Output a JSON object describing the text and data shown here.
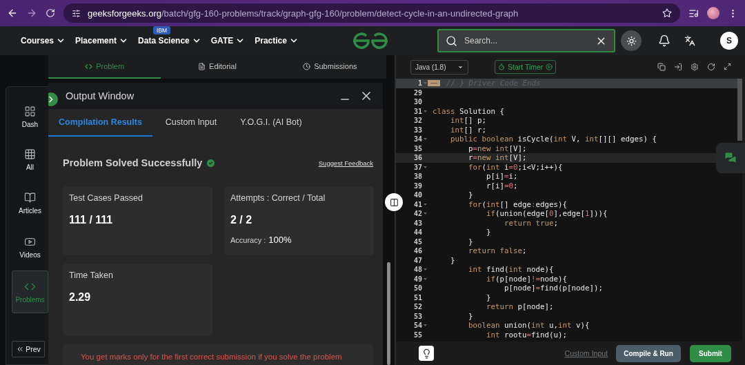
{
  "browser": {
    "url_host": "geeksforgeeks.org",
    "url_path": "/batch/gfg-160-problems/track/graph-gfg-160/problem/detect-cycle-in-an-undirected-graph"
  },
  "nav": {
    "items": [
      {
        "label": "Courses"
      },
      {
        "label": "Placement"
      },
      {
        "label": "Data Science",
        "badge": "IBM"
      },
      {
        "label": "GATE"
      },
      {
        "label": "Practice"
      }
    ],
    "search": {
      "placeholder": "Search..."
    },
    "avatar": "S"
  },
  "problem_tabs": [
    {
      "label": "Problem",
      "selected": true
    },
    {
      "label": "Editorial",
      "selected": false
    },
    {
      "label": "Submissions",
      "selected": false
    }
  ],
  "sidebar": {
    "items": [
      {
        "label": "Dash",
        "selected": false
      },
      {
        "label": "All",
        "selected": false
      },
      {
        "label": "Articles",
        "selected": false
      },
      {
        "label": "Videos",
        "selected": false
      },
      {
        "label": "Problems",
        "selected": true
      }
    ],
    "prev": "Prev"
  },
  "output_window": {
    "title": "Output Window",
    "tabs": [
      {
        "label": "Compilation Results",
        "selected": true
      },
      {
        "label": "Custom Input",
        "selected": false
      },
      {
        "label": "Y.O.G.I. (AI Bot)",
        "selected": false
      }
    ],
    "status": "Problem Solved Successfully",
    "feedback_link": "Suggest Feedback",
    "cards": [
      {
        "label": "Test Cases Passed",
        "value": "111 / 111"
      },
      {
        "label": "Attempts : Correct / Total",
        "value": "2 / 2",
        "extra_label": "Accuracy :",
        "extra_value": "100%"
      },
      {
        "label": "Time Taken",
        "value": "2.29"
      }
    ],
    "notice": "You get marks only for the first correct submission if you solve the problem"
  },
  "editor": {
    "language": "Java (1.8)",
    "timer": "Start Timer",
    "custom_input": "Custom Input",
    "run": "Compile & Run",
    "submit": "Submit",
    "lines": [
      {
        "n": "1",
        "fold": true,
        "folded": true,
        "active": false,
        "tokens": [
          {
            "kind": "comment",
            "text": "// } Driver Code Ends"
          }
        ]
      },
      {
        "n": "29",
        "fold": false,
        "folded": false,
        "active": false
      },
      {
        "n": "30",
        "fold": false,
        "folded": false,
        "active": false
      },
      {
        "n": "31",
        "fold": true,
        "folded": false,
        "active": false,
        "tokens": [
          {
            "kind": "keyword",
            "text": "class"
          },
          {
            "kind": "plain",
            "text": " Solution {"
          }
        ]
      },
      {
        "n": "32",
        "fold": false,
        "folded": false,
        "active": false,
        "tokens": [
          {
            "kind": "keyword",
            "text": "    int"
          },
          {
            "kind": "plain",
            "text": "[] p;"
          }
        ]
      },
      {
        "n": "33",
        "fold": false,
        "folded": false,
        "active": false,
        "tokens": [
          {
            "kind": "keyword",
            "text": "    int"
          },
          {
            "kind": "plain",
            "text": "[] r;"
          }
        ]
      },
      {
        "n": "34",
        "fold": true,
        "folded": false,
        "active": false,
        "tokens": [
          {
            "kind": "keyword",
            "text": "    public boolean"
          },
          {
            "kind": "plain",
            "text": " isCycle("
          },
          {
            "kind": "keyword",
            "text": "int"
          },
          {
            "kind": "plain",
            "text": " V, "
          },
          {
            "kind": "keyword",
            "text": "int"
          },
          {
            "kind": "plain",
            "text": "[][] edges) {"
          }
        ]
      },
      {
        "n": "35",
        "fold": false,
        "folded": false,
        "active": false,
        "tokens": [
          {
            "kind": "plain",
            "text": "        p"
          },
          {
            "kind": "operator",
            "text": "="
          },
          {
            "kind": "keyword",
            "text": "new int"
          },
          {
            "kind": "plain",
            "text": "[V];"
          }
        ]
      },
      {
        "n": "36",
        "fold": false,
        "folded": false,
        "active": true,
        "tokens": [
          {
            "kind": "plain",
            "text": "        r"
          },
          {
            "kind": "operator",
            "text": "="
          },
          {
            "kind": "keyword",
            "text": "new int"
          },
          {
            "kind": "plain",
            "text": "[V];"
          }
        ]
      },
      {
        "n": "37",
        "fold": true,
        "folded": false,
        "active": false,
        "tokens": [
          {
            "kind": "keyword",
            "text": "        for"
          },
          {
            "kind": "plain",
            "text": "("
          },
          {
            "kind": "keyword",
            "text": "int"
          },
          {
            "kind": "plain",
            "text": " i"
          },
          {
            "kind": "operator",
            "text": "="
          },
          {
            "kind": "number",
            "text": "0"
          },
          {
            "kind": "plain",
            "text": ";i<V;i++){"
          }
        ]
      },
      {
        "n": "38",
        "fold": false,
        "folded": false,
        "active": false,
        "tokens": [
          {
            "kind": "plain",
            "text": "            p[i]"
          },
          {
            "kind": "operator",
            "text": "="
          },
          {
            "kind": "plain",
            "text": "i;"
          }
        ]
      },
      {
        "n": "39",
        "fold": false,
        "folded": false,
        "active": false,
        "tokens": [
          {
            "kind": "plain",
            "text": "            r[i]"
          },
          {
            "kind": "operator",
            "text": "="
          },
          {
            "kind": "number",
            "text": "0"
          },
          {
            "kind": "plain",
            "text": ";"
          }
        ]
      },
      {
        "n": "40",
        "fold": false,
        "folded": false,
        "active": false,
        "tokens": [
          {
            "kind": "plain",
            "text": "        }"
          }
        ]
      },
      {
        "n": "41",
        "fold": true,
        "folded": false,
        "active": false,
        "tokens": [
          {
            "kind": "keyword",
            "text": "        for"
          },
          {
            "kind": "plain",
            "text": "("
          },
          {
            "kind": "keyword",
            "text": "int"
          },
          {
            "kind": "plain",
            "text": "[] edge"
          },
          {
            "kind": "operator",
            "text": ":"
          },
          {
            "kind": "plain",
            "text": "edges){"
          }
        ]
      },
      {
        "n": "42",
        "fold": true,
        "folded": false,
        "active": false,
        "tokens": [
          {
            "kind": "keyword",
            "text": "            if"
          },
          {
            "kind": "plain",
            "text": "(union(edge["
          },
          {
            "kind": "number",
            "text": "0"
          },
          {
            "kind": "plain",
            "text": "],edge["
          },
          {
            "kind": "number",
            "text": "1"
          },
          {
            "kind": "plain",
            "text": "])){"
          }
        ]
      },
      {
        "n": "43",
        "fold": false,
        "folded": false,
        "active": false,
        "tokens": [
          {
            "kind": "keyword",
            "text": "                return true"
          },
          {
            "kind": "plain",
            "text": ";"
          }
        ]
      },
      {
        "n": "44",
        "fold": false,
        "folded": false,
        "active": false,
        "tokens": [
          {
            "kind": "plain",
            "text": "            }"
          }
        ]
      },
      {
        "n": "45",
        "fold": false,
        "folded": false,
        "active": false,
        "tokens": [
          {
            "kind": "plain",
            "text": "        }"
          }
        ]
      },
      {
        "n": "46",
        "fold": false,
        "folded": false,
        "active": false,
        "tokens": [
          {
            "kind": "keyword",
            "text": "        return false"
          },
          {
            "kind": "plain",
            "text": ";"
          }
        ]
      },
      {
        "n": "47",
        "fold": false,
        "folded": false,
        "active": false,
        "tokens": [
          {
            "kind": "plain",
            "text": "    }"
          }
        ]
      },
      {
        "n": "48",
        "fold": true,
        "folded": false,
        "active": false,
        "tokens": [
          {
            "kind": "keyword",
            "text": "        int"
          },
          {
            "kind": "plain",
            "text": " find("
          },
          {
            "kind": "keyword",
            "text": "int"
          },
          {
            "kind": "plain",
            "text": " node){"
          }
        ]
      },
      {
        "n": "49",
        "fold": true,
        "folded": false,
        "active": false,
        "tokens": [
          {
            "kind": "keyword",
            "text": "            if"
          },
          {
            "kind": "plain",
            "text": "(p[node]"
          },
          {
            "kind": "operator",
            "text": "!="
          },
          {
            "kind": "plain",
            "text": "node){"
          }
        ]
      },
      {
        "n": "50",
        "fold": false,
        "folded": false,
        "active": false,
        "tokens": [
          {
            "kind": "plain",
            "text": "                p[node]"
          },
          {
            "kind": "operator",
            "text": "="
          },
          {
            "kind": "plain",
            "text": "find(p[node]);"
          }
        ]
      },
      {
        "n": "51",
        "fold": false,
        "folded": false,
        "active": false,
        "tokens": [
          {
            "kind": "plain",
            "text": "            }"
          }
        ]
      },
      {
        "n": "52",
        "fold": false,
        "folded": false,
        "active": false,
        "tokens": [
          {
            "kind": "keyword",
            "text": "            return"
          },
          {
            "kind": "plain",
            "text": " p[node];"
          }
        ]
      },
      {
        "n": "53",
        "fold": false,
        "folded": false,
        "active": false,
        "tokens": [
          {
            "kind": "plain",
            "text": "        }"
          }
        ]
      },
      {
        "n": "54",
        "fold": true,
        "folded": false,
        "active": false,
        "tokens": [
          {
            "kind": "keyword",
            "text": "        boolean"
          },
          {
            "kind": "plain",
            "text": " union("
          },
          {
            "kind": "keyword",
            "text": "int"
          },
          {
            "kind": "plain",
            "text": " u,"
          },
          {
            "kind": "keyword",
            "text": "int"
          },
          {
            "kind": "plain",
            "text": " v){"
          }
        ]
      },
      {
        "n": "55",
        "fold": false,
        "folded": false,
        "active": false,
        "tokens": [
          {
            "kind": "keyword",
            "text": "            int"
          },
          {
            "kind": "plain",
            "text": " rootu"
          },
          {
            "kind": "operator",
            "text": "="
          },
          {
            "kind": "plain",
            "text": "find(u);"
          }
        ]
      }
    ]
  }
}
